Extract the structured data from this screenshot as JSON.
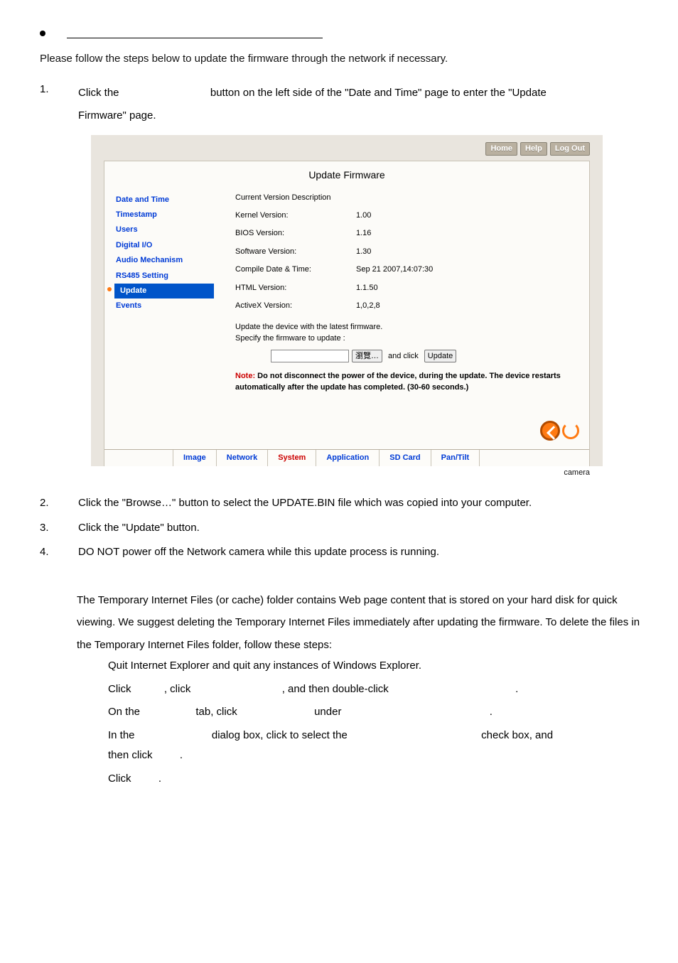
{
  "header": {
    "section_title_blank": ""
  },
  "intro": "Please follow the steps below to update the firmware through the network if necessary.",
  "steps": {
    "s1_a": "Click the",
    "s1_b": "button on the left side of the \"Date and Time\" page to enter the \"Update",
    "s1_c": "Firmware\" page.",
    "s2": "Click the \"Browse…\" button to select the UPDATE.BIN file which was copied into your computer.",
    "s3": "Click the \"Update\" button.",
    "s4": "DO NOT power off the Network camera while this update process is running."
  },
  "screenshot": {
    "topbtns": {
      "home": "Home",
      "help": "Help",
      "logout": "Log Out"
    },
    "title": "Update Firmware",
    "sidebar": [
      "Date and Time",
      "Timestamp",
      "Users",
      "Digital I/O",
      "Audio Mechanism",
      "RS485 Setting",
      "Update",
      "Events"
    ],
    "section_label": "Current Version Description",
    "rows": [
      {
        "k": "Kernel Version:",
        "v": "1.00"
      },
      {
        "k": "BIOS Version:",
        "v": "1.16"
      },
      {
        "k": "Software Version:",
        "v": "1.30"
      },
      {
        "k": "Compile Date & Time:",
        "v": "Sep 21 2007,14:07:30"
      },
      {
        "k": "HTML Version:",
        "v": "1.1.50"
      },
      {
        "k": "ActiveX Version:",
        "v": "1,0,2,8"
      }
    ],
    "hint1": "Update the device with the latest firmware.",
    "hint2": "Specify the firmware to update :",
    "browse": "瀏覽…",
    "andclick": "and click",
    "update_btn": "Update",
    "note_red": "Note:",
    "note_rest": " Do not disconnect the power of the device, during the update. The device restarts automatically after the update has completed. (30-60 seconds.)",
    "tabs": [
      "Image",
      "Network",
      "System",
      "Application",
      "SD Card",
      "Pan/Tilt"
    ],
    "caption": "camera"
  },
  "note": {
    "p": "The Temporary Internet Files (or cache) folder contains Web page content that is stored on your hard disk for quick viewing. We suggest deleting the Temporary Internet Files immediately after updating the firmware. To delete the files in the Temporary Internet Files folder, follow these steps:",
    "r1": "Quit Internet Explorer and quit any instances of Windows Explorer.",
    "r2_a": "Click",
    "r2_b": ", click",
    "r2_c": ", and then double-click",
    "r2_d": ".",
    "r3_a": "On the",
    "r3_b": "tab, click",
    "r3_c": "under",
    "r3_d": ".",
    "r4_a": "In the",
    "r4_b": "dialog box, click to select the",
    "r4_c": "check box, and",
    "r4_d": "then click",
    "r4_e": ".",
    "r5_a": "Click",
    "r5_b": "."
  }
}
